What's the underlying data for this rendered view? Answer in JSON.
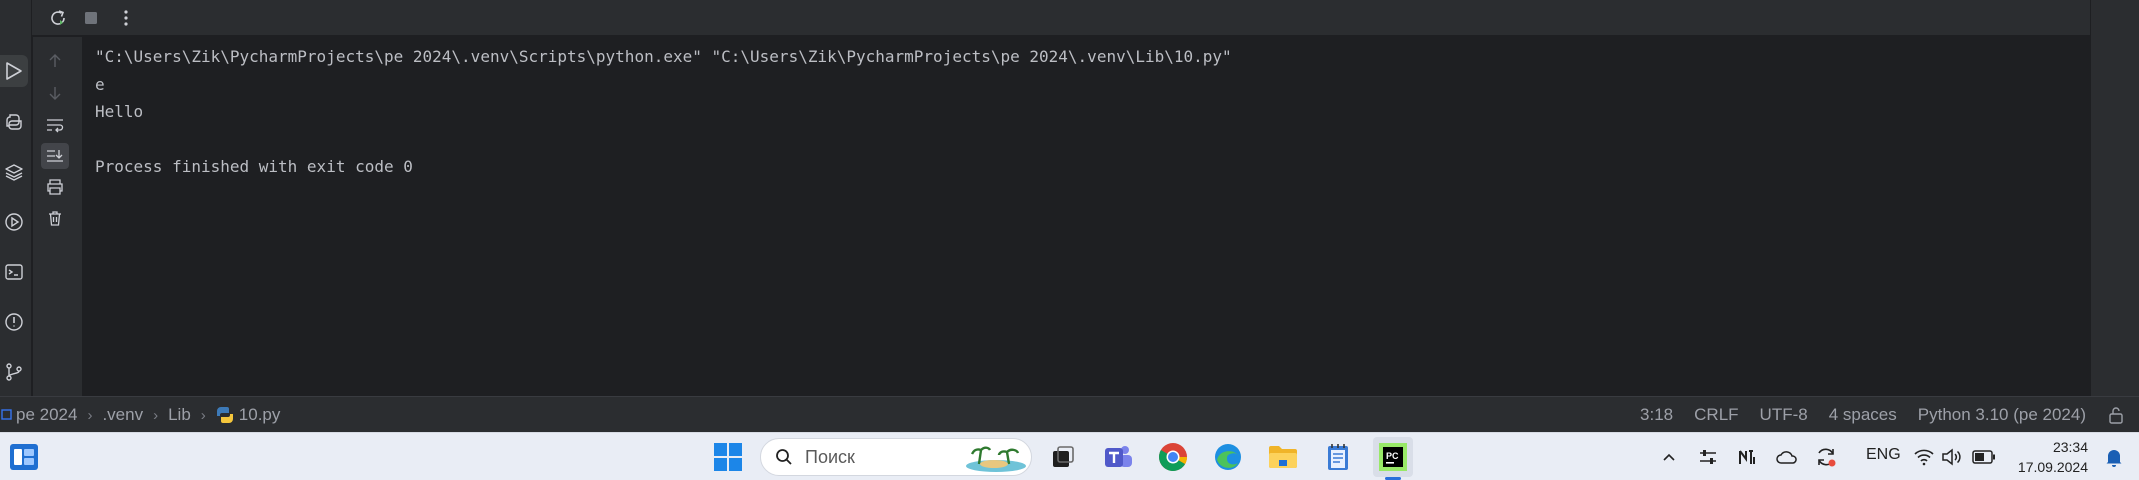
{
  "console": {
    "lines": [
      "\"C:\\Users\\Zik\\PycharmProjects\\pe 2024\\.venv\\Scripts\\python.exe\" \"C:\\Users\\Zik\\PycharmProjects\\pe 2024\\.venv\\Lib\\10.py\"",
      "e",
      "Hello",
      "",
      "Process finished with exit code 0"
    ]
  },
  "breadcrumb": {
    "items": [
      "pe 2024",
      ".venv",
      "Lib",
      "10.py"
    ]
  },
  "status": {
    "position": "3:18",
    "line_ending": "CRLF",
    "encoding": "UTF-8",
    "indent": "4 spaces",
    "interpreter": "Python 3.10 (pe 2024)"
  },
  "taskbar": {
    "search_placeholder": "Поиск",
    "language": "ENG",
    "time": "23:34",
    "date": "17.09.2024"
  },
  "colors": {
    "editor_bg": "#1e1f22",
    "panel_bg": "#2b2d30",
    "text": "#bcbec4",
    "rerun_green": "#5fb865",
    "taskbar_bg": "#e9edf5"
  }
}
